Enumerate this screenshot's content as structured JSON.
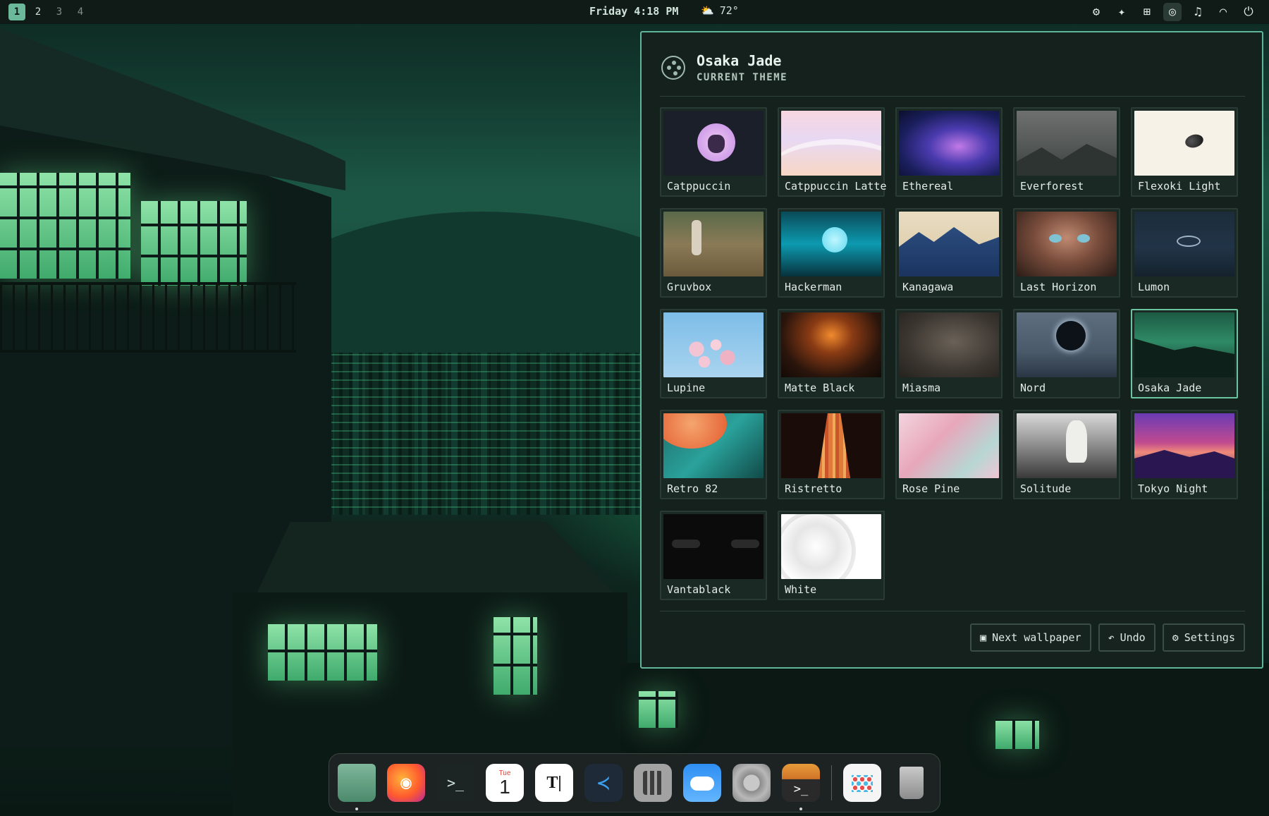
{
  "topbar": {
    "workspaces": [
      "1",
      "2",
      "3",
      "4"
    ],
    "active_workspace": "1",
    "clock": "Friday 4:18 PM",
    "weather": {
      "icon": "sun-cloud-icon",
      "temp": "72°"
    },
    "tray_icons": [
      "gear-icon",
      "sparkle-icon",
      "network-icon",
      "palette-icon",
      "bell-icon",
      "gauge-icon",
      "power-icon"
    ]
  },
  "theme_panel": {
    "title": "Osaka Jade",
    "subtitle": "CURRENT THEME",
    "selected": "Osaka Jade",
    "themes": [
      {
        "name": "Catppuccin"
      },
      {
        "name": "Catppuccin Latte"
      },
      {
        "name": "Ethereal"
      },
      {
        "name": "Everforest"
      },
      {
        "name": "Flexoki Light"
      },
      {
        "name": "Gruvbox"
      },
      {
        "name": "Hackerman"
      },
      {
        "name": "Kanagawa"
      },
      {
        "name": "Last Horizon"
      },
      {
        "name": "Lumon"
      },
      {
        "name": "Lupine"
      },
      {
        "name": "Matte Black"
      },
      {
        "name": "Miasma"
      },
      {
        "name": "Nord"
      },
      {
        "name": "Osaka Jade"
      },
      {
        "name": "Retro 82"
      },
      {
        "name": "Ristretto"
      },
      {
        "name": "Rose Pine"
      },
      {
        "name": "Solitude"
      },
      {
        "name": "Tokyo Night"
      },
      {
        "name": "Vantablack"
      },
      {
        "name": "White"
      }
    ],
    "buttons": {
      "next_wallpaper": "Next wallpaper",
      "undo": "Undo",
      "settings": "Settings"
    },
    "colors": {
      "accent": "#5fb597",
      "panel_bg": "#14211d"
    }
  },
  "dock": {
    "apps": [
      {
        "name": "files-icon",
        "running": true
      },
      {
        "name": "firefox-icon",
        "running": false
      },
      {
        "name": "terminal-icon",
        "running": false
      },
      {
        "name": "calendar-icon",
        "running": false,
        "month": "Tue",
        "day": "1"
      },
      {
        "name": "typora-icon",
        "running": false
      },
      {
        "name": "vscode-icon",
        "running": false
      },
      {
        "name": "calculator-icon",
        "running": false
      },
      {
        "name": "weather-icon",
        "running": false
      },
      {
        "name": "system-settings-icon",
        "running": false
      },
      {
        "name": "ghostty-icon",
        "running": true
      },
      {
        "name": "launchpad-icon",
        "running": false
      },
      {
        "name": "trash-icon",
        "running": false
      }
    ]
  }
}
